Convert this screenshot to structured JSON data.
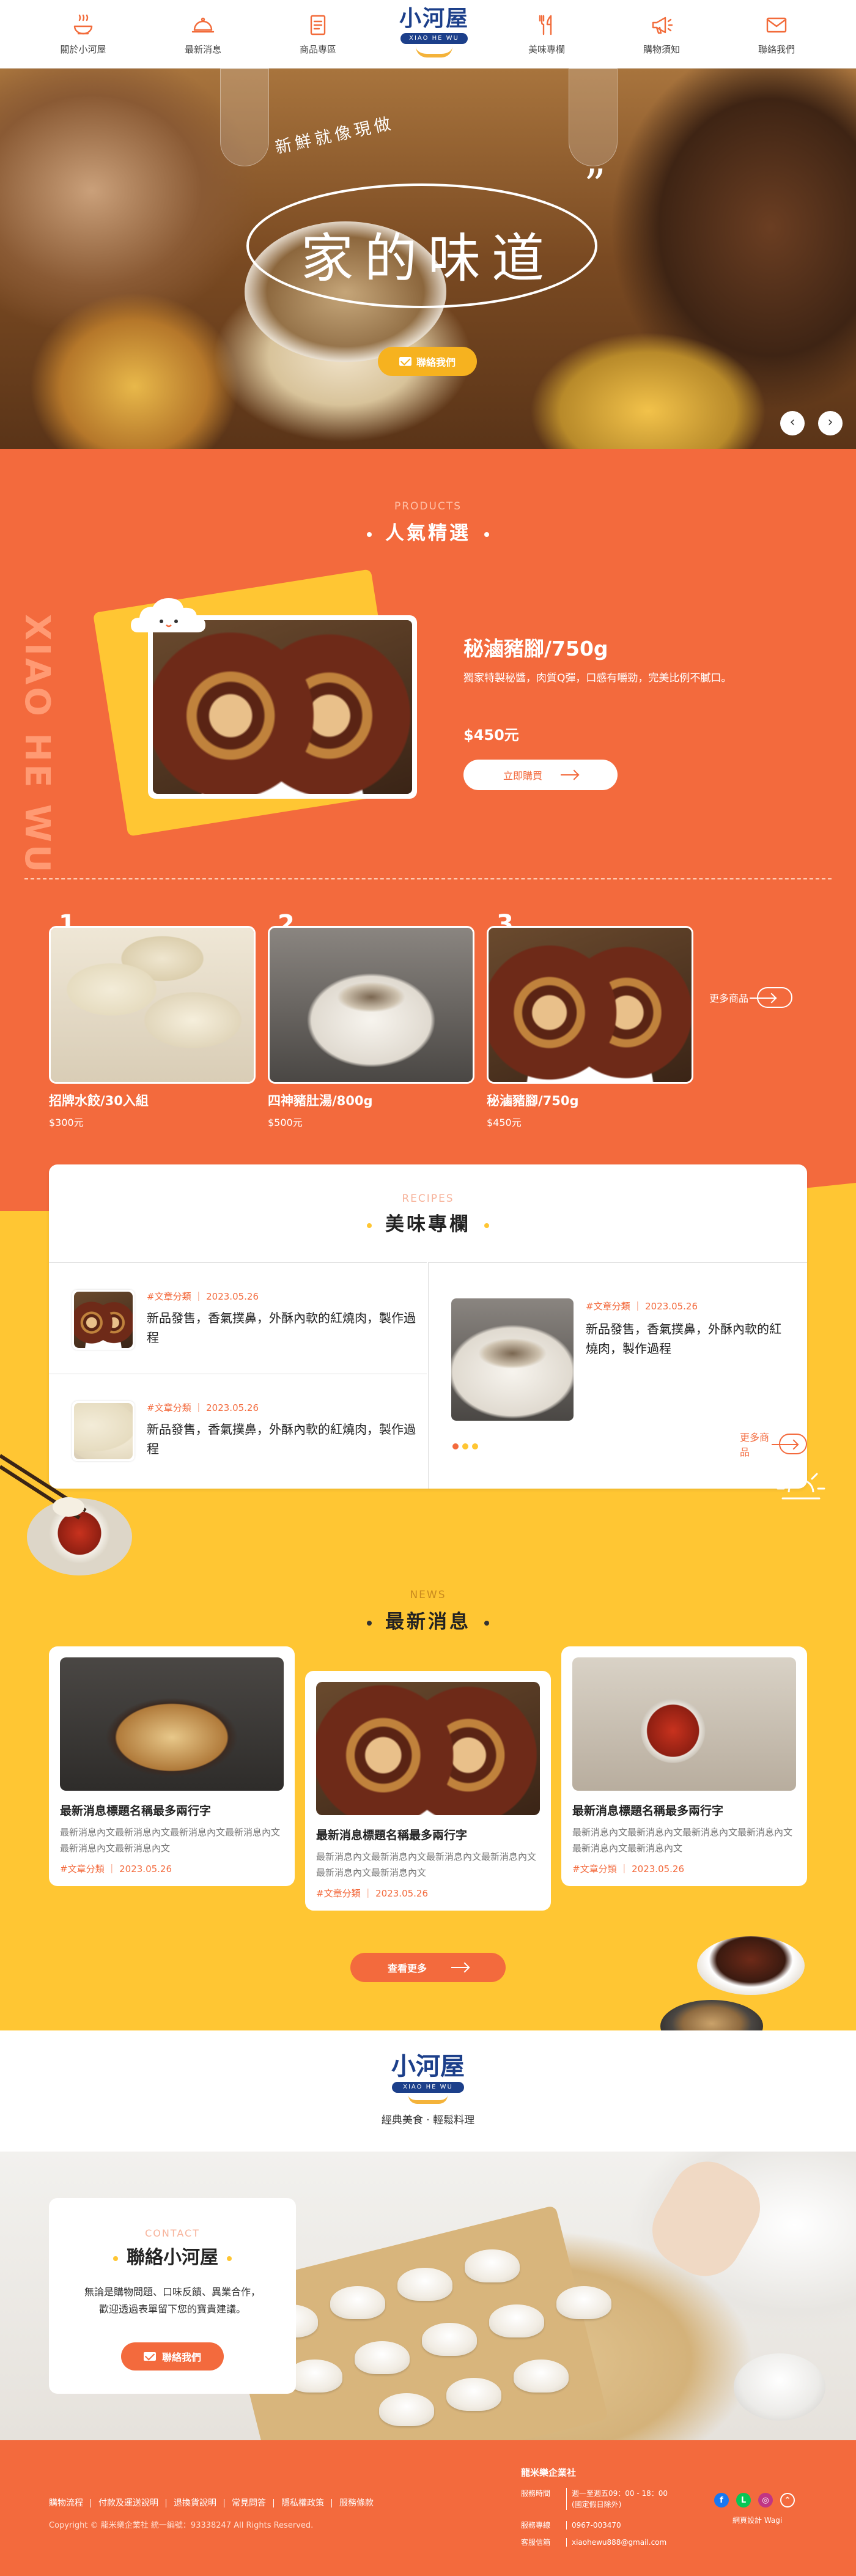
{
  "nav": {
    "items": [
      {
        "label": "關於小河屋",
        "icon": "bowl-icon"
      },
      {
        "label": "最新消息",
        "icon": "cloche-icon"
      },
      {
        "label": "商品專區",
        "icon": "menu-card-icon"
      },
      {
        "label": "美味專欄",
        "icon": "fork-knife-icon"
      },
      {
        "label": "購物須知",
        "icon": "megaphone-icon"
      },
      {
        "label": "聯絡我們",
        "icon": "mail-icon"
      }
    ],
    "logo": {
      "text": "小河屋",
      "ribbon": "XIAO HE WU"
    }
  },
  "hero": {
    "subtitle": "新鮮就像現做",
    "title": "家的味道",
    "cta": "聯絡我們",
    "prev": "‹",
    "next": "›"
  },
  "products": {
    "en": "PRODUCTS",
    "title": "人氣精選",
    "vertical": "XIAO HE WU",
    "featured": {
      "name": "秘滷豬腳/750g",
      "desc": "獨家特製秘醬，肉質Q彈，口感有嚼勁，完美比例不膩口。",
      "price": "$450元",
      "cta": "立即購買"
    },
    "items": [
      {
        "num": "1",
        "name": "招牌水餃/30入組",
        "price": "$300元"
      },
      {
        "num": "2",
        "name": "四神豬肚湯/800g",
        "price": "$500元"
      },
      {
        "num": "3",
        "name": "秘滷豬腳/750g",
        "price": "$450元"
      }
    ],
    "more": "更多商品"
  },
  "recipes": {
    "en": "RECIPES",
    "title": "美味專欄",
    "items": [
      {
        "tag": "#文章分類",
        "date": "2023.05.26",
        "text": "新品發售，香氣撲鼻，外酥內軟的紅燒肉，製作過程"
      },
      {
        "tag": "#文章分類",
        "date": "2023.05.26",
        "text": "新品發售，香氣撲鼻，外酥內軟的紅燒肉，製作過程"
      },
      {
        "tag": "#文章分類",
        "date": "2023.05.26",
        "text": "新品發售，香氣撲鼻，外酥內軟的紅燒肉，製作過程"
      }
    ],
    "more": "更多商品"
  },
  "news": {
    "en": "NEWS",
    "title": "最新消息",
    "items": [
      {
        "title": "最新消息標題名稱最多兩行字",
        "desc": "最新消息內文最新消息內文最新消息內文最新消息內文最新消息內文最新消息內文",
        "tag": "#文章分類",
        "date": "2023.05.26"
      },
      {
        "title": "最新消息標題名稱最多兩行字",
        "desc": "最新消息內文最新消息內文最新消息內文最新消息內文最新消息內文最新消息內文",
        "tag": "#文章分類",
        "date": "2023.05.26"
      },
      {
        "title": "最新消息標題名稱最多兩行字",
        "desc": "最新消息內文最新消息內文最新消息內文最新消息內文最新消息內文最新消息內文",
        "tag": "#文章分類",
        "date": "2023.05.26"
      }
    ],
    "more": "查看更多"
  },
  "band": {
    "logo": "小河屋",
    "ribbon": "XIAO HE WU",
    "slogan": "經典美食 · 輕鬆料理"
  },
  "contact": {
    "en": "CONTACT",
    "title": "聯絡小河屋",
    "desc1": "無論是購物問題、口味反饋、異業合作，",
    "desc2": "歡迎透過表單留下您的寶貴建議。",
    "cta": "聯絡我們"
  },
  "footer": {
    "links": [
      "購物流程",
      "付款及運送說明",
      "退換貨說明",
      "常見問答",
      "隱私權政策",
      "服務條款"
    ],
    "copyright": "Copyright © 龍米樂企業社 統一編號：93338247 All Rights Reserved.",
    "company": "龍米樂企業社",
    "hours_label": "服務時間",
    "hours_1": "週一至週五09：00 - 18：00",
    "hours_2": "(國定假日除外)",
    "phone_label": "服務專線",
    "phone": "0967-003470",
    "email_label": "客服信箱",
    "email": "xiaohewu888@gmail.com",
    "design": "網頁設計 Wagi"
  },
  "colors": {
    "orange": "#f36a3d",
    "yellow": "#ffc633",
    "navy": "#1c3f8a"
  }
}
